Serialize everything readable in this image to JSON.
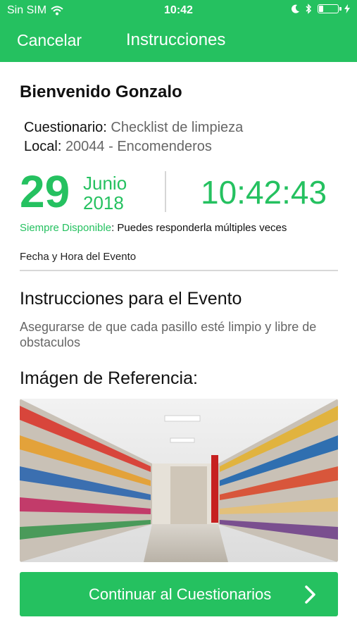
{
  "status_bar": {
    "carrier": "Sin SIM",
    "time": "10:42",
    "icons": [
      "wifi-icon",
      "moon-icon",
      "bluetooth-icon",
      "battery-icon",
      "charging-icon"
    ],
    "battery_level": 0.2
  },
  "nav": {
    "cancel_label": "Cancelar",
    "title": "Instrucciones"
  },
  "greeting": "Bienvenido Gonzalo",
  "questionnaire": {
    "label": "Cuestionario:",
    "value": "Checklist de limpieza"
  },
  "store": {
    "label": "Local:",
    "value": "20044 - Encomenderos"
  },
  "event": {
    "day": "29",
    "month": "Junio",
    "year": "2018",
    "time": "10:42:43",
    "availability_label": "Siempre Disponible",
    "availability_text": ": Puedes responderla múltiples veces",
    "datetime_label": "Fecha y Hora del Evento"
  },
  "instructions": {
    "title": "Instrucciones para el Evento",
    "text": "Asegurarse de que cada pasillo esté limpio y libre de obstaculos"
  },
  "reference": {
    "title": "Imágen de Referencia:"
  },
  "cta_label": "Continuar al Cuestionarios",
  "colors": {
    "primary": "#25c160",
    "muted_text": "#666666",
    "divider": "#d8d8d8"
  }
}
